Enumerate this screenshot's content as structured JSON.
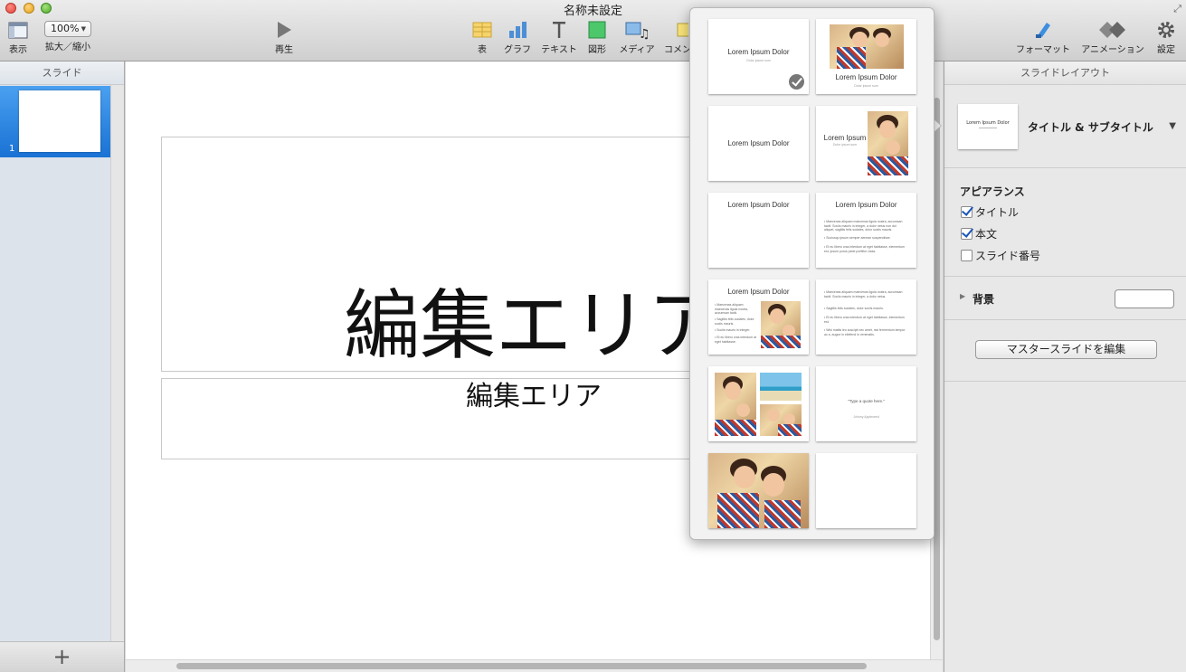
{
  "window": {
    "title": "名称未設定"
  },
  "toolbar": {
    "view_label": "表示",
    "zoom_value": "100%",
    "zoom_label": "拡大／縮小",
    "play_label": "再生",
    "table_label": "表",
    "chart_label": "グラフ",
    "text_label": "テキスト",
    "shape_label": "図形",
    "media_label": "メディア",
    "comment_label": "コメン",
    "format_label": "フォーマット",
    "animation_label": "アニメーション",
    "settings_label": "設定"
  },
  "slides_pane": {
    "header": "スライド",
    "slides": [
      {
        "number": "1"
      }
    ]
  },
  "canvas": {
    "title": "編集エリア",
    "subtitle": "編集エリア"
  },
  "inspector": {
    "header": "スライドレイアウト",
    "layout_name": "タイトル & サブタイトル",
    "layout_thumb_title": "Lorem Ipsum Dolor",
    "appearance_title": "アピアランス",
    "checkboxes": [
      {
        "label": "タイトル",
        "checked": true
      },
      {
        "label": "本文",
        "checked": true
      },
      {
        "label": "スライド番号",
        "checked": false
      }
    ],
    "background_label": "背景",
    "edit_master_button": "マスタースライドを編集"
  },
  "layout_popover": {
    "layouts": [
      {
        "title": "Lorem Ipsum Dolor",
        "sub": "Dolor ipsum sum",
        "selected": true
      },
      {
        "title": "Lorem Ipsum Dolor",
        "sub": "Dolor ipsum sum"
      },
      {
        "title": "Lorem Ipsum Dolor"
      },
      {
        "title": "Lorem Ipsum",
        "sub": "Dolor ipsum sum"
      },
      {
        "title": "Lorem Ipsum Dolor"
      },
      {
        "title": "Lorem Ipsum Dolor",
        "bullets": [
          "Maecenas aliquam maecenas ligula nostra, accumsan taciti. Sociis mauris in integer, a dolor netus non dui aliquet, sagittis felis sodales, dolor sociis mauris.",
          "Sociosqu ipsum semper aenean suspendisse.",
          "Et eu libero cras interdum at eget habitasse, elementum est, ipsum purus pede porttitor class."
        ]
      },
      {
        "title": "Lorem Ipsum Dolor",
        "bullets": [
          "Maecenas aliquam maecenas ligula nostra, accumsan taciti.",
          "Sagittis felis sodales, dolor sociis mauris.",
          "Sociis mauris in integer.",
          "Et eu libero cras interdum at eget habitasse."
        ]
      },
      {
        "bullets": [
          "Maecenas aliquam maecenas ligula nostra, accumsan taciti. Sociis mauris in integer, a dolor netus.",
          "Sagittis felis sodales, dolor sociis mauris.",
          "Et eu libero cras interdum at eget habitasse, elementum est.",
          "Wisi mattis leo suscipit nec amet, nisi fermentum tempor ac a, augue in eleifend in venenatis."
        ]
      },
      {},
      {
        "quote": "\"Type a quote here.\"",
        "attribution": "Johnny Appleseed"
      },
      {},
      {}
    ]
  },
  "colors": {
    "selection_blue": "#1a72d4",
    "checkbox_check": "#1a56b8"
  }
}
